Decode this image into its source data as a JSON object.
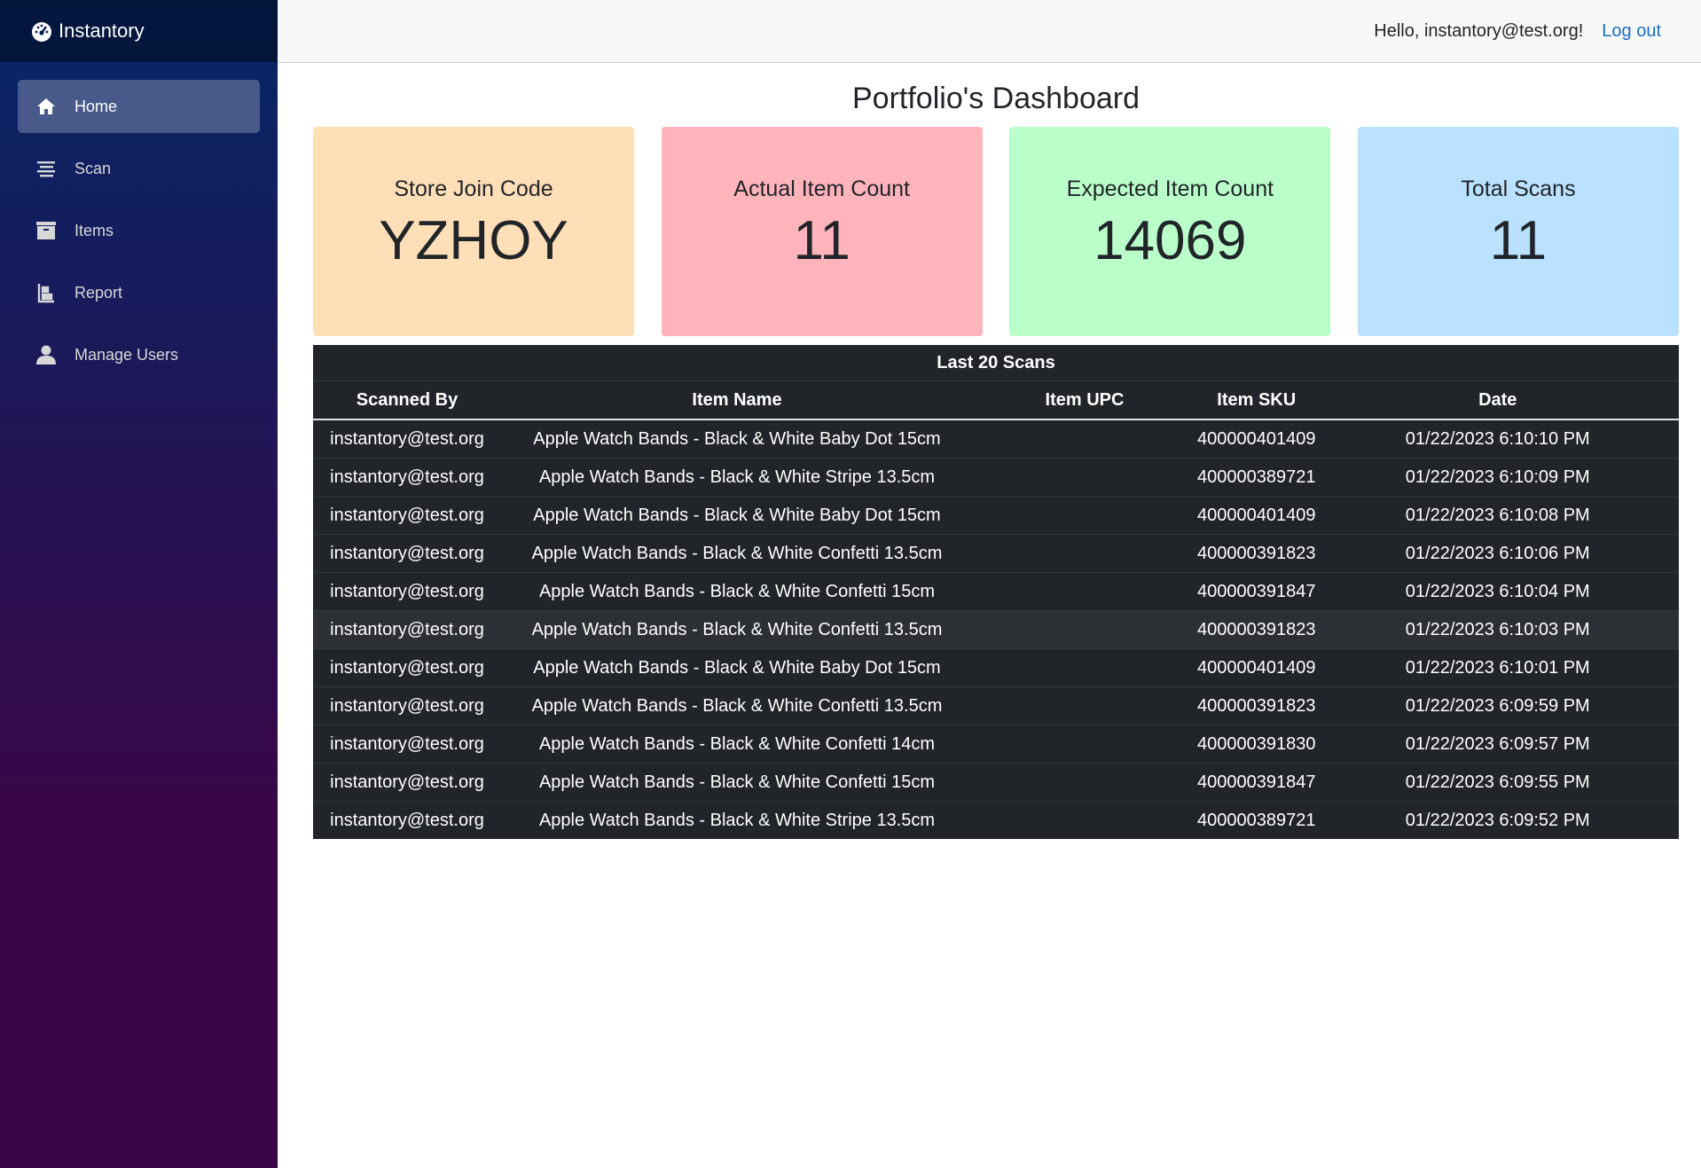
{
  "brand": {
    "name": "Instantory",
    "icon": "dashboard-icon"
  },
  "sidebar": {
    "items": [
      {
        "label": "Home",
        "icon": "home-icon",
        "active": true
      },
      {
        "label": "Scan",
        "icon": "list-icon"
      },
      {
        "label": "Items",
        "icon": "box-icon"
      },
      {
        "label": "Report",
        "icon": "report-icon"
      },
      {
        "label": "Manage Users",
        "icon": "user-icon"
      }
    ]
  },
  "header": {
    "greeting": "Hello, instantory@test.org!",
    "logout": "Log out"
  },
  "page": {
    "title": "Portfolio's Dashboard"
  },
  "cards": [
    {
      "label": "Store Join Code",
      "value": "YZHOY",
      "color": "#ffdfb8"
    },
    {
      "label": "Actual Item Count",
      "value": "11",
      "color": "#ffb3bb"
    },
    {
      "label": "Expected Item Count",
      "value": "14069",
      "color": "#baffc9"
    },
    {
      "label": "Total Scans",
      "value": "11",
      "color": "#bae1ff"
    }
  ],
  "scans": {
    "caption": "Last 20 Scans",
    "columns": [
      "Scanned By",
      "Item Name",
      "Item UPC",
      "Item SKU",
      "Date"
    ],
    "rows": [
      [
        "instantory@test.org",
        "Apple Watch Bands - Black & White Baby Dot 15cm",
        "",
        "400000401409",
        "01/22/2023 6:10:10 PM"
      ],
      [
        "instantory@test.org",
        "Apple Watch Bands - Black & White Stripe 13.5cm",
        "",
        "400000389721",
        "01/22/2023 6:10:09 PM"
      ],
      [
        "instantory@test.org",
        "Apple Watch Bands - Black & White Baby Dot 15cm",
        "",
        "400000401409",
        "01/22/2023 6:10:08 PM"
      ],
      [
        "instantory@test.org",
        "Apple Watch Bands - Black & White Confetti 13.5cm",
        "",
        "400000391823",
        "01/22/2023 6:10:06 PM"
      ],
      [
        "instantory@test.org",
        "Apple Watch Bands - Black & White Confetti 15cm",
        "",
        "400000391847",
        "01/22/2023 6:10:04 PM"
      ],
      [
        "instantory@test.org",
        "Apple Watch Bands - Black & White Confetti 13.5cm",
        "",
        "400000391823",
        "01/22/2023 6:10:03 PM"
      ],
      [
        "instantory@test.org",
        "Apple Watch Bands - Black & White Baby Dot 15cm",
        "",
        "400000401409",
        "01/22/2023 6:10:01 PM"
      ],
      [
        "instantory@test.org",
        "Apple Watch Bands - Black & White Confetti 13.5cm",
        "",
        "400000391823",
        "01/22/2023 6:09:59 PM"
      ],
      [
        "instantory@test.org",
        "Apple Watch Bands - Black & White Confetti 14cm",
        "",
        "400000391830",
        "01/22/2023 6:09:57 PM"
      ],
      [
        "instantory@test.org",
        "Apple Watch Bands - Black & White Confetti 15cm",
        "",
        "400000391847",
        "01/22/2023 6:09:55 PM"
      ],
      [
        "instantory@test.org",
        "Apple Watch Bands - Black & White Stripe 13.5cm",
        "",
        "400000389721",
        "01/22/2023 6:09:52 PM"
      ]
    ]
  }
}
